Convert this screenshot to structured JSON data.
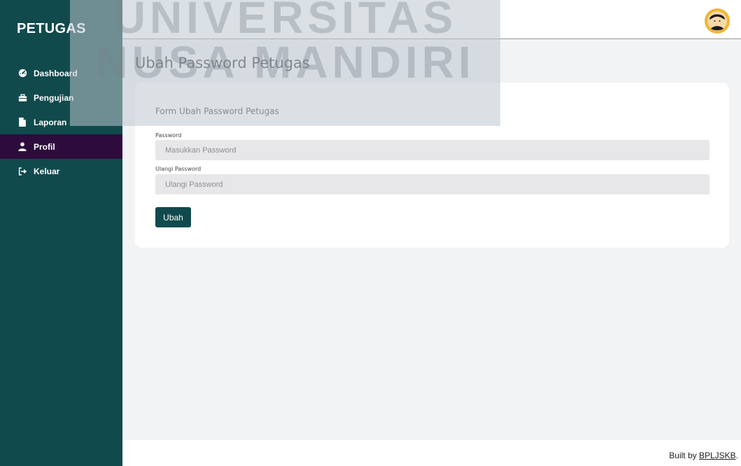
{
  "sidebar": {
    "brand": "PETUGAS",
    "items": [
      {
        "label": "Dashboard",
        "icon": "dashboard-gauge-icon"
      },
      {
        "label": "Pengujian",
        "icon": "briefcase-icon"
      },
      {
        "label": "Laporan",
        "icon": "file-icon"
      },
      {
        "label": "Profil",
        "icon": "user-icon",
        "active": true
      },
      {
        "label": "Keluar",
        "icon": "sign-out-icon"
      }
    ]
  },
  "header": {
    "avatar_icon": "user-avatar-icon"
  },
  "page": {
    "title": "Ubah Password Petugas"
  },
  "form": {
    "title": "Form Ubah Password Petugas",
    "password_label": "Password",
    "password_placeholder": "Masukkan Password",
    "repeat_label": "Ulangi Password",
    "repeat_placeholder": "Ulangi Password",
    "submit_label": "Ubah"
  },
  "footer": {
    "prefix": "Built by ",
    "link": "BPLJSKB",
    "suffix": "."
  },
  "watermark": {
    "line1": "UNIVERSITAS",
    "line2": "NUSA MANDIRI"
  },
  "colors": {
    "sidebar": "#114a4d",
    "active_item": "#2e0b3d",
    "avatar": "#f2b632"
  }
}
